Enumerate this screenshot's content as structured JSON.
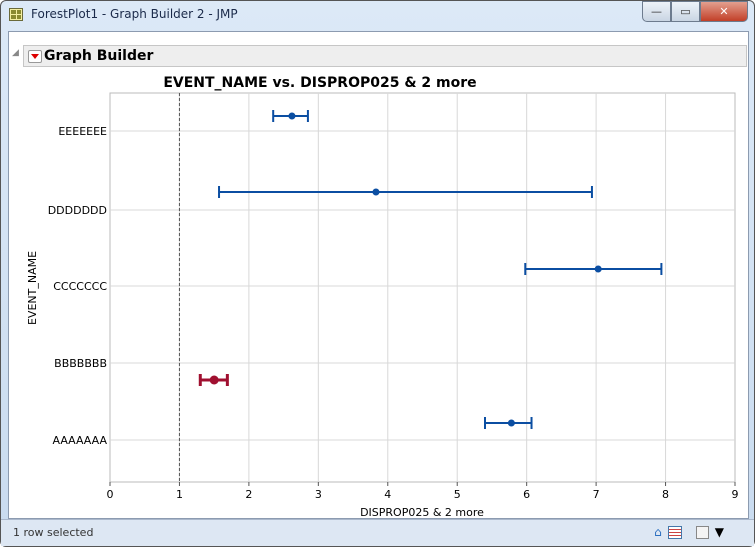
{
  "window": {
    "title": "ForestPlot1 - Graph Builder 2 - JMP",
    "minimize": "—",
    "maximize": "▭",
    "close": "✕"
  },
  "panel": {
    "title": "Graph Builder"
  },
  "status": {
    "text": "1 row selected",
    "home": "⌂",
    "dropdown": "▼"
  },
  "chart_data": {
    "type": "scatter",
    "title": "EVENT_NAME vs. DISPROP025 & 2 more",
    "xlabel": "DISPROP025 & 2 more",
    "ylabel": "EVENT_NAME",
    "xlim": [
      0,
      9
    ],
    "xticks": [
      0,
      1,
      2,
      3,
      4,
      5,
      6,
      7,
      8,
      9
    ],
    "reference_line_x": 1,
    "grid": true,
    "categories": [
      "EEEEEEE",
      "DDDDDDD",
      "CCCCCCC",
      "BBBBBBB",
      "AAAAAAA"
    ],
    "points": [
      {
        "category": "EEEEEEE",
        "low": 2.35,
        "estimate": 2.62,
        "high": 2.85,
        "selected": false
      },
      {
        "category": "DDDDDDD",
        "low": 1.57,
        "estimate": 3.83,
        "high": 6.94,
        "selected": false
      },
      {
        "category": "CCCCCCC",
        "low": 5.98,
        "estimate": 7.03,
        "high": 7.94,
        "selected": false
      },
      {
        "category": "BBBBBBB",
        "low": 1.3,
        "estimate": 1.5,
        "high": 1.69,
        "selected": true
      },
      {
        "category": "AAAAAAA",
        "low": 5.4,
        "estimate": 5.78,
        "high": 6.07,
        "selected": false
      }
    ],
    "colors": {
      "normal": "#0b4ea2",
      "selected": "#a01030"
    }
  }
}
